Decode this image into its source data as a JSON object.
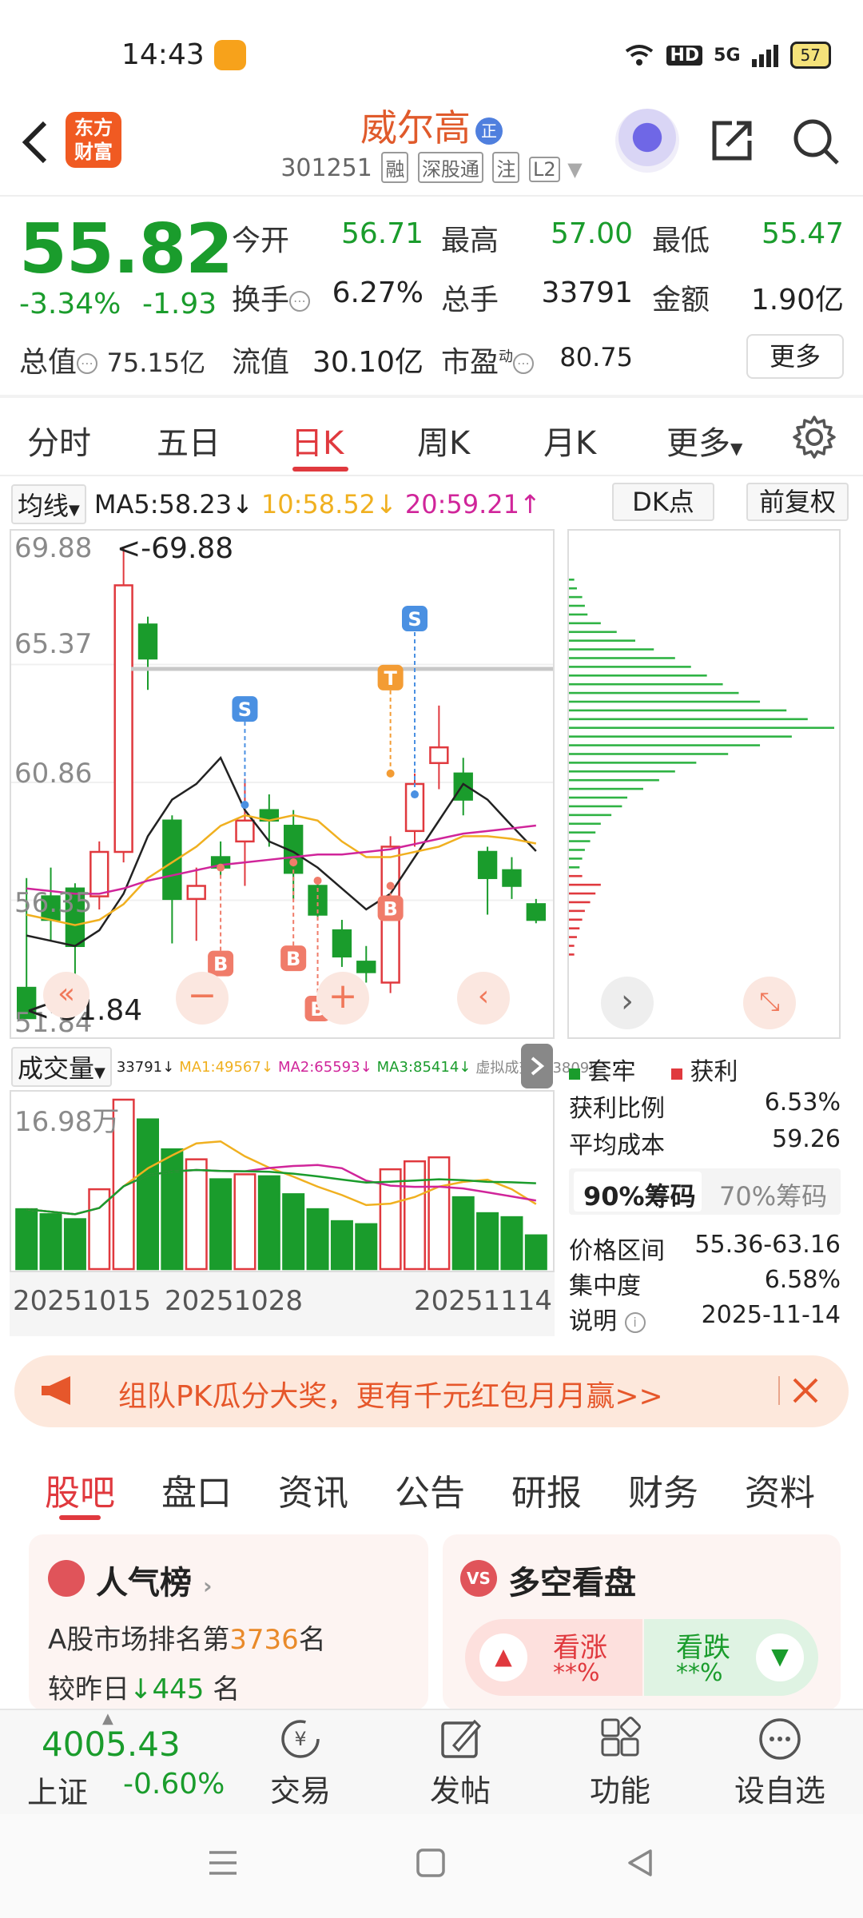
{
  "status": {
    "time": "14:43",
    "signal": "5G",
    "hd": "HD",
    "battery": "57"
  },
  "header": {
    "logo_line1": "东方",
    "logo_line2": "财富",
    "name": "威尔高",
    "name_tag": "正",
    "code": "301251",
    "tags": [
      "融",
      "深股通",
      "注",
      "L2"
    ]
  },
  "quote": {
    "price": "55.82",
    "change_pct": "-3.34%",
    "change_abs": "-1.93",
    "open_label": "今开",
    "open": "56.71",
    "high_label": "最高",
    "high": "57.00",
    "low_label": "最低",
    "low": "55.47",
    "turnover_label": "换手",
    "turnover": "6.27%",
    "volume_label": "总手",
    "volume": "33791",
    "amount_label": "金额",
    "amount": "1.90亿",
    "total_cap_label": "总值",
    "total_cap": "75.15亿",
    "float_cap_label": "流值",
    "float_cap": "30.10亿",
    "pe_label": "市盈",
    "pe_sup": "动",
    "pe": "80.75",
    "more": "更多"
  },
  "period_tabs": [
    "分时",
    "五日",
    "日K",
    "周K",
    "月K",
    "更多"
  ],
  "ma": {
    "type": "均线",
    "ma5": "MA5:58.23",
    "ma10": "10:58.52",
    "ma20": "20:59.21",
    "dk": "DK点",
    "adjust": "前复权"
  },
  "kline": {
    "y_labels": [
      "69.88",
      "65.37",
      "60.86",
      "56.35",
      "51.84"
    ],
    "max_note": "<-69.88",
    "min_note": "<-51.84",
    "signals": [
      "S",
      "S",
      "T",
      "B",
      "B",
      "B",
      "B"
    ]
  },
  "volume": {
    "type": "成交量",
    "vol": "33791",
    "ma1": "MA1:49567",
    "ma2": "MA2:65593",
    "ma3": "MA3:85414",
    "virtual": "虚拟成交量:38095",
    "max_label": "16.98万",
    "dates": [
      "20251015",
      "20251028",
      "20251114"
    ]
  },
  "chart_data": {
    "type": "candlestick",
    "ylim": [
      51.84,
      69.88
    ],
    "categories": [
      "1",
      "2",
      "3",
      "4",
      "5",
      "6",
      "7",
      "8",
      "9",
      "10",
      "11",
      "12",
      "13",
      "14",
      "15",
      "16",
      "17",
      "18",
      "19",
      "20",
      "21",
      "22"
    ],
    "ohlc": [
      [
        53.0,
        57.2,
        51.84,
        51.84
      ],
      [
        56.5,
        57.6,
        54.8,
        55.6
      ],
      [
        56.8,
        57.0,
        52.6,
        54.6
      ],
      [
        56.5,
        58.6,
        56.0,
        58.2
      ],
      [
        58.2,
        69.88,
        57.8,
        68.4
      ],
      [
        66.9,
        67.2,
        64.4,
        65.6
      ],
      [
        59.4,
        59.6,
        54.7,
        56.4
      ],
      [
        56.4,
        57.6,
        54.8,
        56.9
      ],
      [
        58.0,
        58.6,
        57.3,
        57.6
      ],
      [
        58.6,
        61.0,
        56.9,
        59.4
      ],
      [
        59.8,
        60.4,
        58.4,
        59.4
      ],
      [
        59.2,
        59.8,
        56.4,
        57.4
      ],
      [
        56.9,
        57.1,
        55.6,
        55.8
      ],
      [
        55.2,
        55.6,
        53.8,
        54.2
      ],
      [
        54.0,
        54.6,
        53.2,
        53.6
      ],
      [
        53.2,
        58.8,
        52.8,
        58.4
      ],
      [
        59.0,
        61.2,
        58.4,
        60.8
      ],
      [
        61.6,
        63.8,
        60.6,
        62.2
      ],
      [
        61.2,
        61.8,
        59.6,
        60.2
      ],
      [
        58.2,
        58.4,
        55.8,
        57.2
      ],
      [
        57.5,
        58.0,
        56.4,
        56.9
      ],
      [
        56.2,
        56.4,
        55.47,
        55.6
      ]
    ],
    "ma5": [
      55.0,
      54.8,
      54.6,
      55.2,
      56.6,
      58.8,
      60.2,
      60.8,
      61.8,
      59.8,
      58.6,
      58.2,
      57.6,
      56.8,
      56.0,
      56.6,
      58.0,
      59.4,
      60.8,
      60.2,
      59.2,
      58.23
    ],
    "ma10": [
      55.8,
      55.6,
      55.4,
      55.6,
      56.2,
      57.2,
      57.8,
      58.4,
      59.2,
      59.6,
      59.4,
      59.6,
      59.4,
      58.6,
      58.0,
      58.0,
      58.2,
      58.4,
      58.8,
      58.8,
      58.7,
      58.52
    ],
    "ma20": [
      56.8,
      56.7,
      56.6,
      56.6,
      56.8,
      57.1,
      57.3,
      57.5,
      57.7,
      57.8,
      57.9,
      58.0,
      58.1,
      58.1,
      58.2,
      58.3,
      58.5,
      58.7,
      58.9,
      59.0,
      59.1,
      59.21
    ],
    "volume_max": 169800,
    "volumes": [
      60000,
      55000,
      50000,
      80000,
      169800,
      150000,
      120000,
      110000,
      90000,
      95000,
      93000,
      75000,
      60000,
      48000,
      45000,
      100000,
      108000,
      112000,
      72000,
      56000,
      52000,
      33791
    ]
  },
  "chips": {
    "legend_locked": "套牢",
    "legend_profit": "获利",
    "profit_ratio_label": "获利比例",
    "profit_ratio": "6.53%",
    "avg_cost_label": "平均成本",
    "avg_cost": "59.26",
    "tab_90": "90%筹码",
    "tab_70": "70%筹码",
    "range_label": "价格区间",
    "range": "55.36-63.16",
    "concentration_label": "集中度",
    "concentration": "6.58%",
    "note_label": "说明",
    "note_date": "2025-11-14",
    "profit_levels": [
      0.05,
      0.12,
      0.1,
      0.08,
      0.06,
      0.05,
      0.04,
      0.03,
      0.02,
      0.02
    ],
    "locked_levels": [
      0.02,
      0.03,
      0.05,
      0.06,
      0.07,
      0.12,
      0.18,
      0.25,
      0.32,
      0.4,
      0.46,
      0.52,
      0.58,
      0.64,
      0.72,
      0.82,
      0.9,
      1.0,
      0.84,
      0.72,
      0.6,
      0.48,
      0.4,
      0.34,
      0.28,
      0.22,
      0.2,
      0.16,
      0.12,
      0.1,
      0.08,
      0.06,
      0.05,
      0.04
    ]
  },
  "banner": {
    "text": "组队PK瓜分大奖，更有千元红包月月赢>>"
  },
  "bottom_tabs": [
    "股吧",
    "盘口",
    "资讯",
    "公告",
    "研报",
    "财务",
    "资料"
  ],
  "popularity": {
    "title": "人气榜",
    "rank_prefix": "A股市场排名第",
    "rank": "3736",
    "rank_suffix": "名",
    "change_prefix": "较昨日",
    "change": "445",
    "change_suffix": "名"
  },
  "versus": {
    "title": "多空看盘",
    "bull": "看涨",
    "bull_val": "**%",
    "bear": "看跌",
    "bear_val": "**%"
  },
  "footer": {
    "index_value": "4005.43",
    "index_name": "上证",
    "index_change": "-0.60%",
    "tabs": [
      "交易",
      "发帖",
      "功能",
      "设自选"
    ]
  },
  "colors": {
    "up": "#e0393e",
    "down": "#1a9c2c",
    "accent": "#e05a2b",
    "ma5": "#222222",
    "ma10": "#f0b020",
    "ma20": "#d0259a"
  }
}
